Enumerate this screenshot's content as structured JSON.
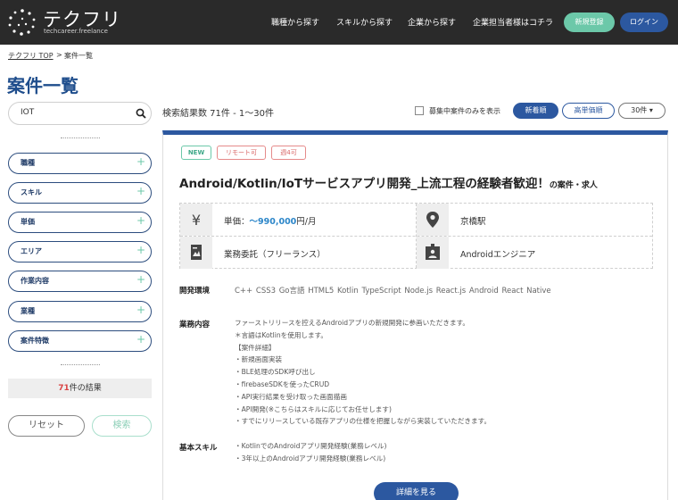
{
  "header": {
    "logo_title": "テクフリ",
    "logo_sub": "techcareer.freelance",
    "nav": [
      "職種から探す",
      "スキルから探す",
      "企業から探す",
      "企業担当者様はコチラ"
    ],
    "register": "新規登録",
    "login": "ログイン"
  },
  "breadcrumb": {
    "home": "テクフリ TOP",
    "sep": ">",
    "current": "案件一覧"
  },
  "page_title": "案件一覧",
  "sidebar": {
    "search_value": "IOT",
    "filters": [
      "職種",
      "スキル",
      "単価",
      "エリア",
      "作業内容",
      "業種",
      "案件特徴"
    ],
    "result_count": "71",
    "result_suffix": "件の結果",
    "reset": "リセット",
    "search": "検索"
  },
  "results": {
    "count_text": "検索結果数 71件 - 1～30件",
    "checkbox_label": "募集中案件のみを表示",
    "sort_new": "新着順",
    "sort_price": "高単価順",
    "per_page": "30件 ▾"
  },
  "job": {
    "tags": [
      "NEW",
      "リモート可",
      "週4可"
    ],
    "title": "Android/Kotlin/IoTサービスアプリ開発_上流工程の経験者歓迎！",
    "title_suffix": "の案件・求人",
    "price_label": "単価：",
    "price_value": "～990,000",
    "price_unit": "円/月",
    "location": "京橋駅",
    "contract": "業務委託（フリーランス）",
    "role": "Androidエンジニア",
    "env_label": "開発環境",
    "env": "C++ CSS3 Go言語 HTML5 Kotlin TypeScript Node.js React.js Android React Native",
    "work_label": "業務内容",
    "work": [
      "ファーストリリースを控えるAndroidアプリの新規開発に参画いただきます。",
      "＊言語はKotlinを使用します。",
      "【案件詳細】",
      "・新規画面実装",
      "・BLE処理のSDK呼び出し",
      "・firebaseSDKを使ったCRUD",
      "・API実行結果を受け取った画面描画",
      "・API開発(※こちらはスキルに応じてお任せします)",
      "・すでにリリースしている既存アプリの仕様を把握しながら実装していただきます。"
    ],
    "skill_label": "基本スキル",
    "skills": [
      "・KotlinでのAndroidアプリ開発経験(業務レベル)",
      "・3年以上のAndroidアプリ開発経験(業務レベル)"
    ],
    "detail_button": "詳細を見る"
  },
  "colors": {
    "brand_navy": "#2c58a0",
    "accent_green": "#6cc8a9",
    "header_bg": "#2a2a2a",
    "title_blue": "#1e4d8c",
    "tag_red": "#d86565"
  },
  "icons": [
    "logo-mark-icon",
    "search-icon",
    "plus-icon",
    "yen-icon",
    "location-pin-icon",
    "contract-document-icon",
    "id-badge-icon"
  ]
}
